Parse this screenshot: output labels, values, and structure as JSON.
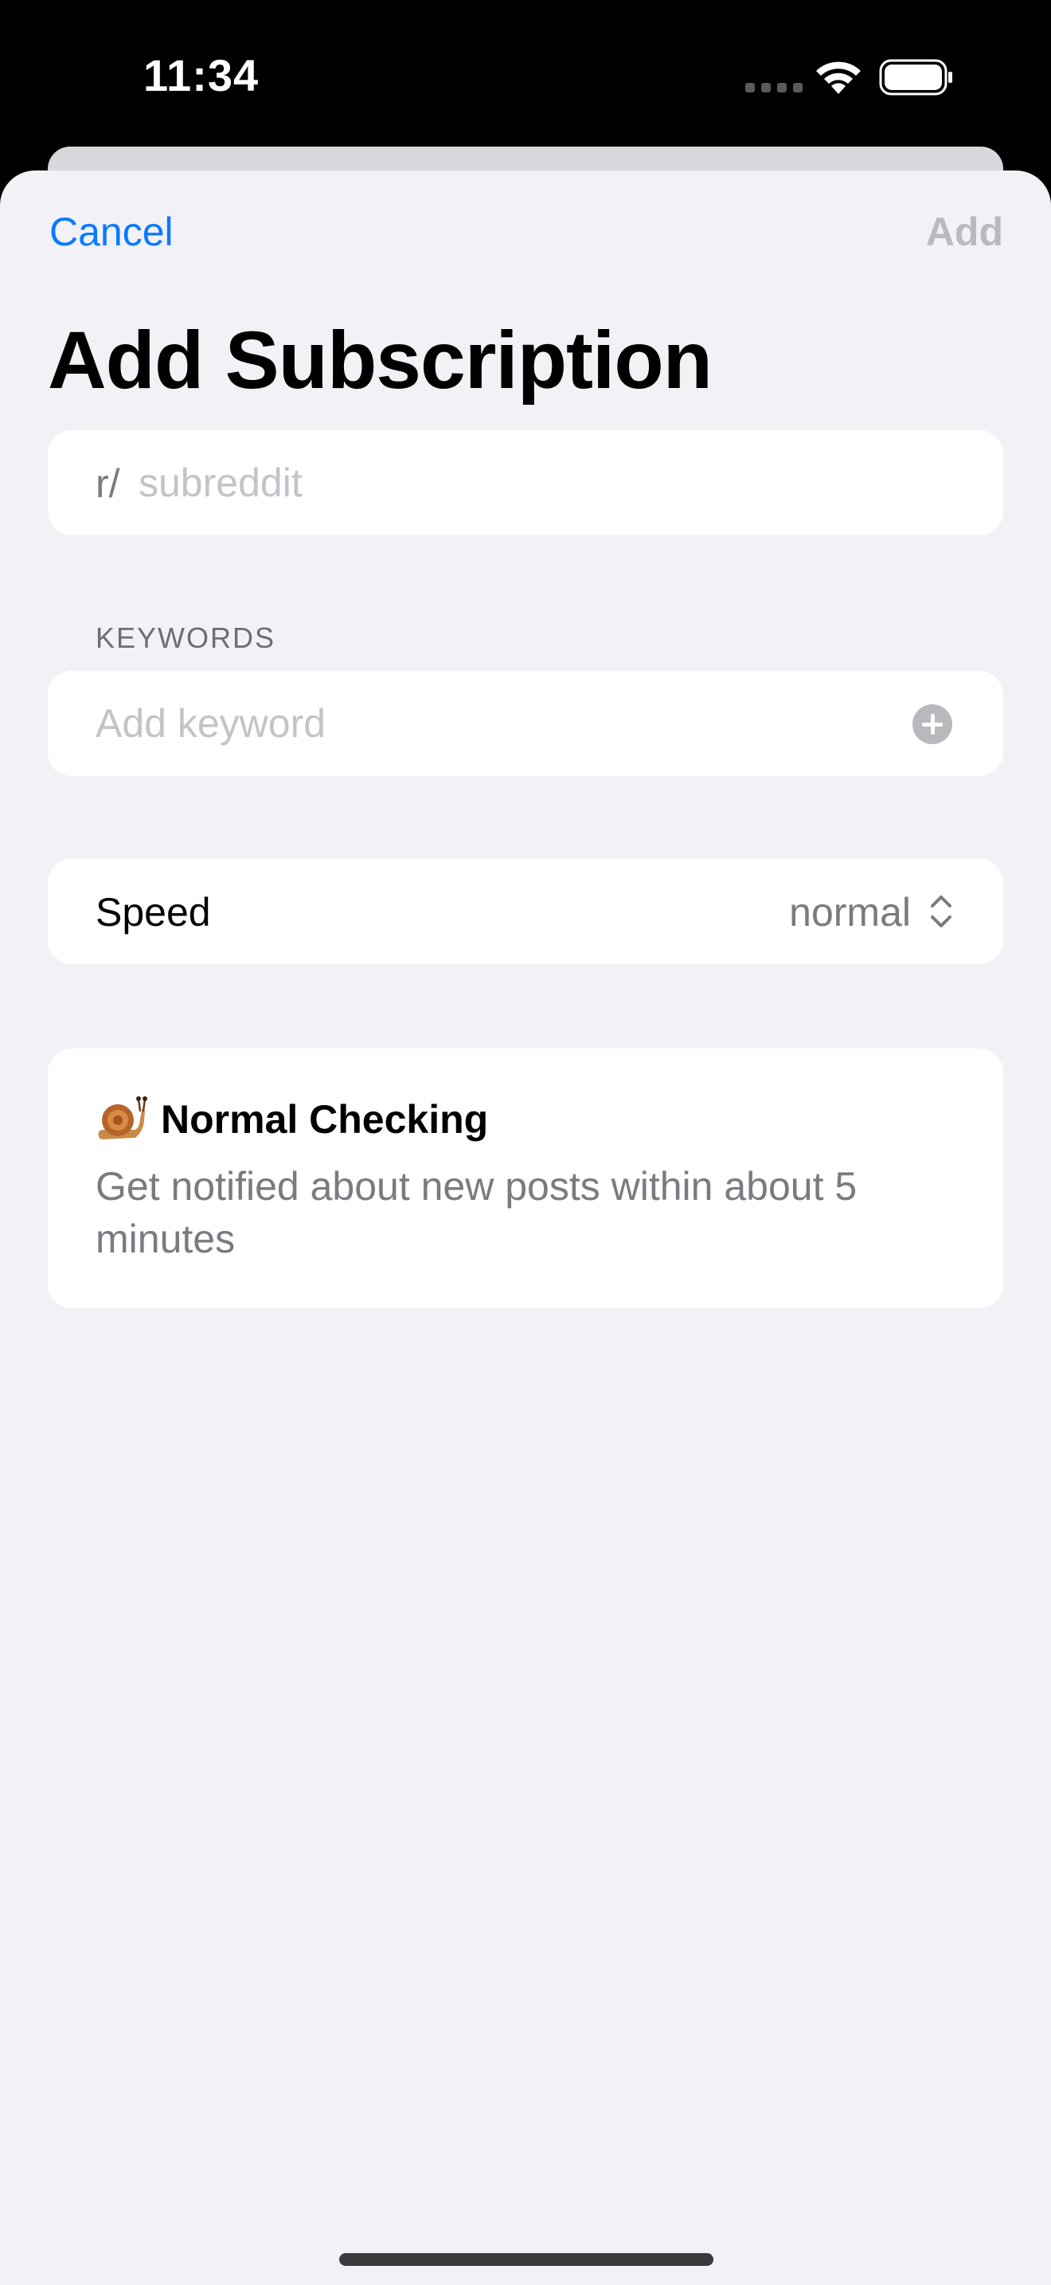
{
  "status_bar": {
    "time": "11:34"
  },
  "nav": {
    "cancel_label": "Cancel",
    "add_label": "Add"
  },
  "page": {
    "title": "Add Subscription"
  },
  "subreddit": {
    "prefix": "r/",
    "placeholder": "subreddit",
    "value": ""
  },
  "keywords": {
    "section_header": "KEYWORDS",
    "placeholder": "Add keyword",
    "value": ""
  },
  "speed": {
    "label": "Speed",
    "value": "normal"
  },
  "info": {
    "icon": "snail-icon",
    "title": "Normal Checking",
    "description": "Get notified about new posts within about 5 minutes"
  },
  "colors": {
    "accent": "#0a7aff",
    "disabled": "#b9b9be",
    "background": "#f1f1f6",
    "secondary_text": "#7a7a80"
  }
}
